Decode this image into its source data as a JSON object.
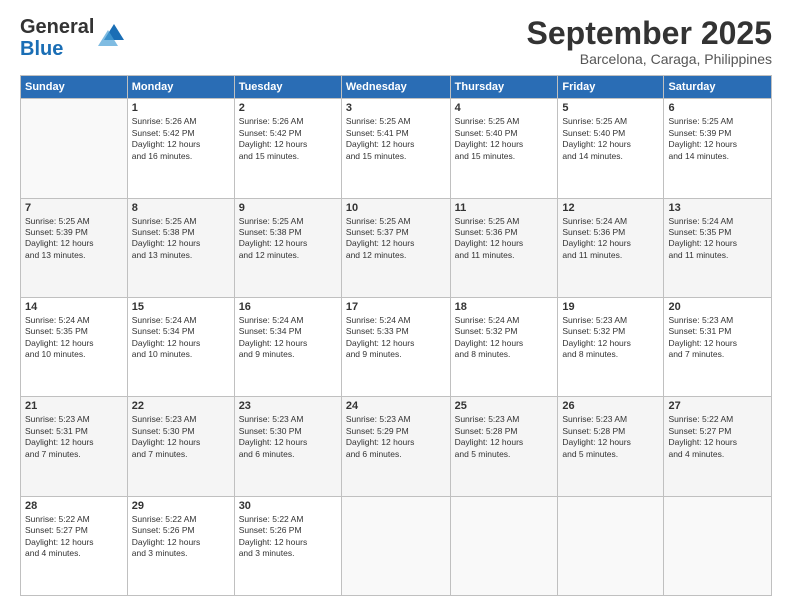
{
  "logo": {
    "line1": "General",
    "line2": "Blue"
  },
  "title": "September 2025",
  "subtitle": "Barcelona, Caraga, Philippines",
  "days_header": [
    "Sunday",
    "Monday",
    "Tuesday",
    "Wednesday",
    "Thursday",
    "Friday",
    "Saturday"
  ],
  "weeks": [
    [
      {
        "num": "",
        "info": ""
      },
      {
        "num": "1",
        "info": "Sunrise: 5:26 AM\nSunset: 5:42 PM\nDaylight: 12 hours\nand 16 minutes."
      },
      {
        "num": "2",
        "info": "Sunrise: 5:26 AM\nSunset: 5:42 PM\nDaylight: 12 hours\nand 15 minutes."
      },
      {
        "num": "3",
        "info": "Sunrise: 5:25 AM\nSunset: 5:41 PM\nDaylight: 12 hours\nand 15 minutes."
      },
      {
        "num": "4",
        "info": "Sunrise: 5:25 AM\nSunset: 5:40 PM\nDaylight: 12 hours\nand 15 minutes."
      },
      {
        "num": "5",
        "info": "Sunrise: 5:25 AM\nSunset: 5:40 PM\nDaylight: 12 hours\nand 14 minutes."
      },
      {
        "num": "6",
        "info": "Sunrise: 5:25 AM\nSunset: 5:39 PM\nDaylight: 12 hours\nand 14 minutes."
      }
    ],
    [
      {
        "num": "7",
        "info": "Sunrise: 5:25 AM\nSunset: 5:39 PM\nDaylight: 12 hours\nand 13 minutes."
      },
      {
        "num": "8",
        "info": "Sunrise: 5:25 AM\nSunset: 5:38 PM\nDaylight: 12 hours\nand 13 minutes."
      },
      {
        "num": "9",
        "info": "Sunrise: 5:25 AM\nSunset: 5:38 PM\nDaylight: 12 hours\nand 12 minutes."
      },
      {
        "num": "10",
        "info": "Sunrise: 5:25 AM\nSunset: 5:37 PM\nDaylight: 12 hours\nand 12 minutes."
      },
      {
        "num": "11",
        "info": "Sunrise: 5:25 AM\nSunset: 5:36 PM\nDaylight: 12 hours\nand 11 minutes."
      },
      {
        "num": "12",
        "info": "Sunrise: 5:24 AM\nSunset: 5:36 PM\nDaylight: 12 hours\nand 11 minutes."
      },
      {
        "num": "13",
        "info": "Sunrise: 5:24 AM\nSunset: 5:35 PM\nDaylight: 12 hours\nand 11 minutes."
      }
    ],
    [
      {
        "num": "14",
        "info": "Sunrise: 5:24 AM\nSunset: 5:35 PM\nDaylight: 12 hours\nand 10 minutes."
      },
      {
        "num": "15",
        "info": "Sunrise: 5:24 AM\nSunset: 5:34 PM\nDaylight: 12 hours\nand 10 minutes."
      },
      {
        "num": "16",
        "info": "Sunrise: 5:24 AM\nSunset: 5:34 PM\nDaylight: 12 hours\nand 9 minutes."
      },
      {
        "num": "17",
        "info": "Sunrise: 5:24 AM\nSunset: 5:33 PM\nDaylight: 12 hours\nand 9 minutes."
      },
      {
        "num": "18",
        "info": "Sunrise: 5:24 AM\nSunset: 5:32 PM\nDaylight: 12 hours\nand 8 minutes."
      },
      {
        "num": "19",
        "info": "Sunrise: 5:23 AM\nSunset: 5:32 PM\nDaylight: 12 hours\nand 8 minutes."
      },
      {
        "num": "20",
        "info": "Sunrise: 5:23 AM\nSunset: 5:31 PM\nDaylight: 12 hours\nand 7 minutes."
      }
    ],
    [
      {
        "num": "21",
        "info": "Sunrise: 5:23 AM\nSunset: 5:31 PM\nDaylight: 12 hours\nand 7 minutes."
      },
      {
        "num": "22",
        "info": "Sunrise: 5:23 AM\nSunset: 5:30 PM\nDaylight: 12 hours\nand 7 minutes."
      },
      {
        "num": "23",
        "info": "Sunrise: 5:23 AM\nSunset: 5:30 PM\nDaylight: 12 hours\nand 6 minutes."
      },
      {
        "num": "24",
        "info": "Sunrise: 5:23 AM\nSunset: 5:29 PM\nDaylight: 12 hours\nand 6 minutes."
      },
      {
        "num": "25",
        "info": "Sunrise: 5:23 AM\nSunset: 5:28 PM\nDaylight: 12 hours\nand 5 minutes."
      },
      {
        "num": "26",
        "info": "Sunrise: 5:23 AM\nSunset: 5:28 PM\nDaylight: 12 hours\nand 5 minutes."
      },
      {
        "num": "27",
        "info": "Sunrise: 5:22 AM\nSunset: 5:27 PM\nDaylight: 12 hours\nand 4 minutes."
      }
    ],
    [
      {
        "num": "28",
        "info": "Sunrise: 5:22 AM\nSunset: 5:27 PM\nDaylight: 12 hours\nand 4 minutes."
      },
      {
        "num": "29",
        "info": "Sunrise: 5:22 AM\nSunset: 5:26 PM\nDaylight: 12 hours\nand 3 minutes."
      },
      {
        "num": "30",
        "info": "Sunrise: 5:22 AM\nSunset: 5:26 PM\nDaylight: 12 hours\nand 3 minutes."
      },
      {
        "num": "",
        "info": ""
      },
      {
        "num": "",
        "info": ""
      },
      {
        "num": "",
        "info": ""
      },
      {
        "num": "",
        "info": ""
      }
    ]
  ]
}
